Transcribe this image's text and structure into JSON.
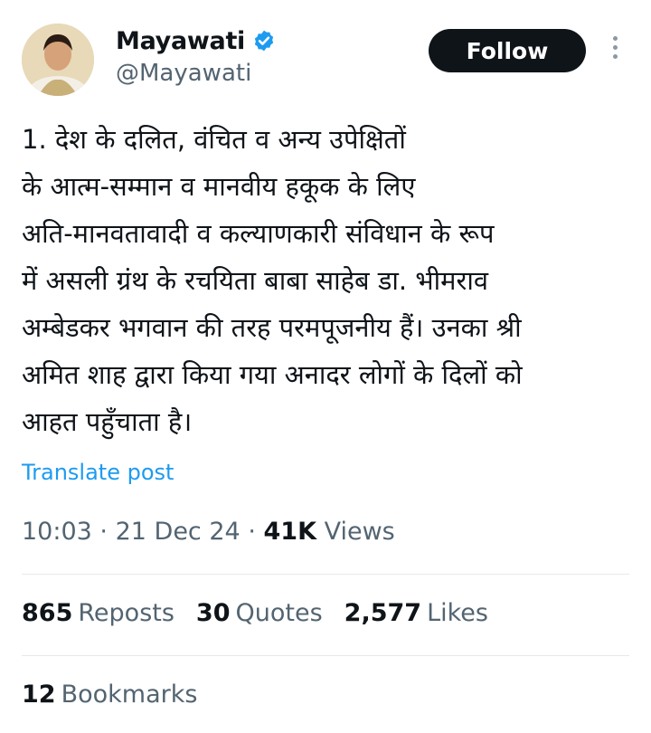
{
  "author": {
    "display_name": "Mayawati",
    "handle": "@Mayawati",
    "verified": true,
    "verified_color": "#1d9bf0"
  },
  "follow_label": "Follow",
  "post": {
    "text": "1. देश के दलित, वंचित व अन्य उपेक्षितों\nके आत्म-सम्मान व मानवीय हकूक के लिए\nअति-मानवतावादी व कल्याणकारी संविधान के रूप\nमें असली ग्रंथ के रचयिता बाबा साहेब डा. भीमराव\nअम्बेडकर भगवान की तरह परमपूजनीय हैं। उनका श्री\nअमित शाह द्वारा किया गया अनादर लोगों के दिलों को\nआहत पहुँचाता है।",
    "translate_label": "Translate post",
    "time": "10:03",
    "date": "21 Dec 24",
    "separator": "·",
    "views_count": "41K",
    "views_label": "Views"
  },
  "stats": {
    "reposts_count": "865",
    "reposts_label": "Reposts",
    "quotes_count": "30",
    "quotes_label": "Quotes",
    "likes_count": "2,577",
    "likes_label": "Likes",
    "bookmarks_count": "12",
    "bookmarks_label": "Bookmarks"
  },
  "colors": {
    "text": "#0f1419",
    "secondary": "#536471",
    "link": "#1d9bf0",
    "button_bg": "#0f1419"
  }
}
